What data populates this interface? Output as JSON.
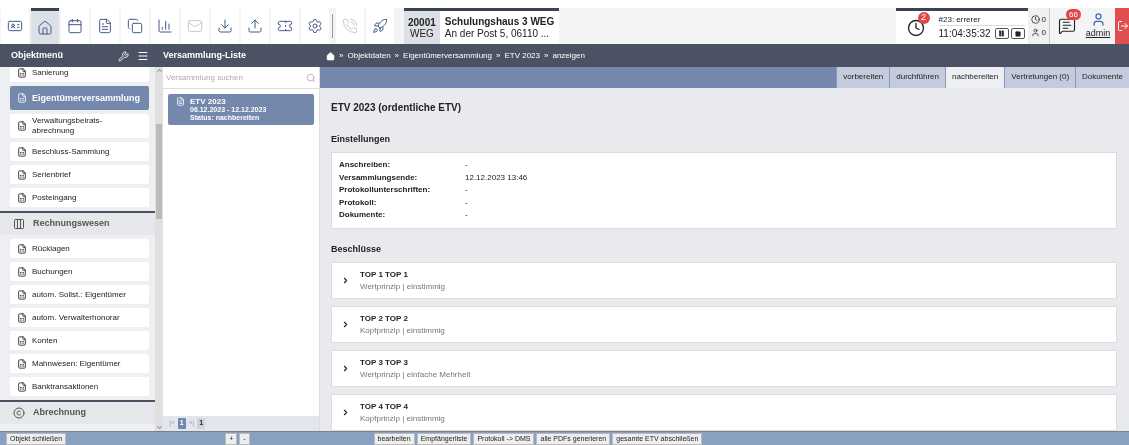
{
  "toolbar": {
    "buttons": [
      {
        "kind": "contact-card",
        "selected": false,
        "disabled": false
      },
      {
        "kind": "home",
        "selected": true,
        "disabled": false
      },
      {
        "kind": "calendar",
        "selected": false,
        "disabled": false
      },
      {
        "kind": "form",
        "selected": false,
        "disabled": false
      },
      {
        "kind": "copy",
        "selected": false,
        "disabled": false
      },
      {
        "kind": "chart",
        "selected": false,
        "disabled": false
      },
      {
        "kind": "mail",
        "selected": false,
        "disabled": true
      },
      {
        "kind": "download",
        "selected": false,
        "disabled": false
      },
      {
        "kind": "upload",
        "selected": false,
        "disabled": false
      },
      {
        "kind": "ticket",
        "selected": false,
        "disabled": false
      },
      {
        "kind": "settings",
        "selected": false,
        "disabled": false
      },
      {
        "kind": "phone",
        "selected": false,
        "disabled": true
      },
      {
        "kind": "rocket",
        "selected": false,
        "disabled": false
      }
    ],
    "object": {
      "number": "20001",
      "type": "WEG",
      "name": "Schulungshaus 3 WEG",
      "address": "An der Post 5, 06110 ..."
    },
    "timer": {
      "badge": "2",
      "task": "#23: errerer",
      "time": "11:04:35:32"
    },
    "counters": [
      "0",
      "0"
    ],
    "messages_badge": "66",
    "user": "admin"
  },
  "header": {
    "sidebar_title": "Objektmenü",
    "list_title": "Versammlung-Liste",
    "breadcrumb": [
      {
        "separator": "»",
        "label": "Objektdaten"
      },
      {
        "separator": "»",
        "label": "Eigentümerversammlung"
      },
      {
        "separator": "»",
        "label": "ETV 2023"
      },
      {
        "separator": "»",
        "label": "anzeigen"
      }
    ]
  },
  "sidebar": {
    "items": [
      {
        "kind": "item",
        "label": "Sanierung",
        "selected": false
      },
      {
        "kind": "item",
        "label": "Eigentümerversammlung",
        "selected": true
      },
      {
        "kind": "item",
        "label": "Verwaltungsbeirats-abrechnung",
        "selected": false
      },
      {
        "kind": "item",
        "label": "Beschluss-Sammlung",
        "selected": false
      },
      {
        "kind": "item",
        "label": "Serienbrief",
        "selected": false
      },
      {
        "kind": "item",
        "label": "Posteingang",
        "selected": false
      },
      {
        "kind": "section",
        "label": "Rechnungswesen"
      },
      {
        "kind": "item",
        "label": "Rücklagen",
        "selected": false
      },
      {
        "kind": "item",
        "label": "Buchungen",
        "selected": false
      },
      {
        "kind": "item",
        "label": "autom. Sollst.: Eigentümer",
        "selected": false
      },
      {
        "kind": "item",
        "label": "autom. Verwalterhonorar",
        "selected": false
      },
      {
        "kind": "item",
        "label": "Konten",
        "selected": false
      },
      {
        "kind": "item",
        "label": "Mahnwesen: Eigentümer",
        "selected": false
      },
      {
        "kind": "item",
        "label": "Banktransaktionen",
        "selected": false
      },
      {
        "kind": "section",
        "label": "Abrechnung"
      }
    ]
  },
  "list": {
    "search_placeholder": "Versammlung suchen",
    "items": [
      {
        "title": "ETV 2023",
        "dates": "06.12.2023 - 12.12.2023",
        "status": "Status: nachbereiten",
        "selected": true
      }
    ],
    "pager": {
      "first": "|«",
      "page": "1",
      "last": "»|",
      "total": "1"
    }
  },
  "tabs": [
    {
      "label": "vorbereiten",
      "selected": false
    },
    {
      "label": "durchführen",
      "selected": false
    },
    {
      "label": "nachbereiten",
      "selected": true
    },
    {
      "label": "Vertretungen (0)",
      "selected": false
    },
    {
      "label": "Dokumente",
      "selected": false
    }
  ],
  "main": {
    "title": "ETV 2023 (ordentliche ETV)",
    "settings_title": "Einstellungen",
    "settings": [
      {
        "label": "Anschreiben:",
        "value": "-"
      },
      {
        "label": "Versammlungsende:",
        "value": "12.12.2023 13:46"
      },
      {
        "label": "Protokollunterschriften:",
        "value": "-"
      },
      {
        "label": "Protokoll:",
        "value": "-"
      },
      {
        "label": "Dokumente:",
        "value": "-"
      }
    ],
    "resolutions_title": "Beschlüsse",
    "resolutions": [
      {
        "title": "TOP 1 TOP 1",
        "subtitle": "Wertprinzip | einstimmig"
      },
      {
        "title": "TOP 2 TOP 2",
        "subtitle": "Kopfprinzip | einstimmig"
      },
      {
        "title": "TOP 3 TOP 3",
        "subtitle": "Wertprinzip | einfache Mehrheit"
      },
      {
        "title": "TOP 4 TOP 4",
        "subtitle": "Kopfprinzip | einstimmig"
      }
    ]
  },
  "bottom": {
    "left_button": "Objekt schließen",
    "list_buttons": [
      "+",
      "-"
    ],
    "actions": [
      "bearbeiten",
      "Empfängerliste",
      "Protokoll -> DMS",
      "alle PDFs generieren",
      "gesamte ETV abschließen"
    ]
  }
}
